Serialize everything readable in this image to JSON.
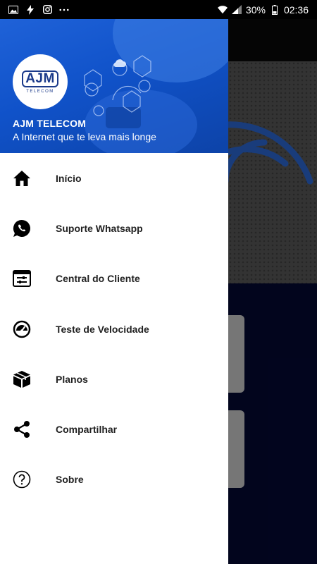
{
  "status_bar": {
    "battery_percent": "30%",
    "time": "02:36",
    "icons": [
      "image-icon",
      "flash-icon",
      "instagram-icon",
      "more-icon",
      "wifi-icon",
      "signal-icon",
      "battery-icon"
    ]
  },
  "drawer": {
    "header": {
      "logo_text": "AJM",
      "logo_subtext": "TELECOM",
      "title": "AJM TELECOM",
      "subtitle": "A Internet que te leva mais longe"
    },
    "items": [
      {
        "label": "Início",
        "icon": "home-icon"
      },
      {
        "label": "Suporte Whatsapp",
        "icon": "whatsapp-icon"
      },
      {
        "label": "Central do Cliente",
        "icon": "client-panel-icon"
      },
      {
        "label": "Teste de Velocidade",
        "icon": "speedometer-icon"
      },
      {
        "label": "Planos",
        "icon": "package-icon"
      },
      {
        "label": "Compartilhar",
        "icon": "share-icon"
      },
      {
        "label": "Sobre",
        "icon": "help-circle-icon"
      }
    ]
  },
  "colors": {
    "header_blue": "#1052c9",
    "logo_blue": "#1b3a8a",
    "app_dark_blue": "#040a36",
    "menu_text": "#212121"
  }
}
